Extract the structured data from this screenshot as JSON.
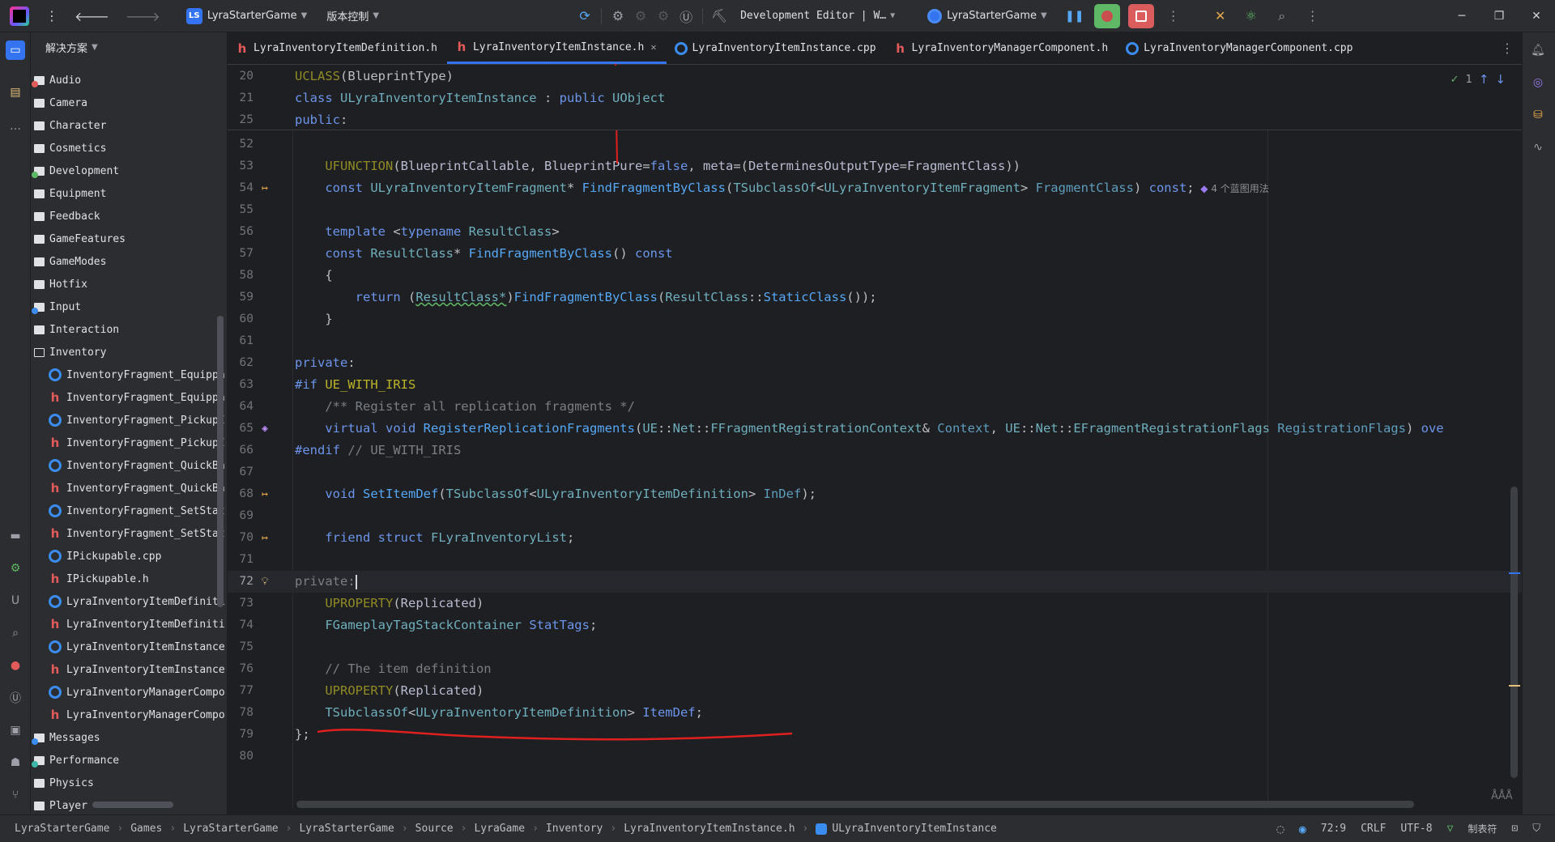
{
  "titlebar": {
    "project_badge": "LS",
    "project_name": "LyraStarterGame",
    "vcs_label": "版本控制",
    "run_config": "Development Editor | W…",
    "target": "LyraStarterGame"
  },
  "project_panel": {
    "header": "解决方案",
    "items": [
      {
        "label": "Audio",
        "kind": "folder",
        "indent": 0,
        "dot": "#e25a5a"
      },
      {
        "label": "Camera",
        "kind": "folder",
        "indent": 0
      },
      {
        "label": "Character",
        "kind": "folder",
        "indent": 0
      },
      {
        "label": "Cosmetics",
        "kind": "folder",
        "indent": 0
      },
      {
        "label": "Development",
        "kind": "folder",
        "indent": 0,
        "dot": "#5fb865"
      },
      {
        "label": "Equipment",
        "kind": "folder",
        "indent": 0
      },
      {
        "label": "Feedback",
        "kind": "folder",
        "indent": 0
      },
      {
        "label": "GameFeatures",
        "kind": "folder",
        "indent": 0
      },
      {
        "label": "GameModes",
        "kind": "folder",
        "indent": 0
      },
      {
        "label": "Hotfix",
        "kind": "folder",
        "indent": 0
      },
      {
        "label": "Input",
        "kind": "folder",
        "indent": 0,
        "dot": "#3b8cef"
      },
      {
        "label": "Interaction",
        "kind": "folder",
        "indent": 0
      },
      {
        "label": "Inventory",
        "kind": "folder-open",
        "indent": 0
      },
      {
        "label": "InventoryFragment_Equippa",
        "kind": "cpp",
        "indent": 1
      },
      {
        "label": "InventoryFragment_Equippa",
        "kind": "h",
        "indent": 1
      },
      {
        "label": "InventoryFragment_PickupI",
        "kind": "cpp",
        "indent": 1
      },
      {
        "label": "InventoryFragment_PickupI",
        "kind": "h",
        "indent": 1
      },
      {
        "label": "InventoryFragment_QuickBa",
        "kind": "cpp",
        "indent": 1
      },
      {
        "label": "InventoryFragment_QuickBa",
        "kind": "h",
        "indent": 1
      },
      {
        "label": "InventoryFragment_SetStat",
        "kind": "cpp",
        "indent": 1
      },
      {
        "label": "InventoryFragment_SetStat",
        "kind": "h",
        "indent": 1
      },
      {
        "label": "IPickupable.cpp",
        "kind": "cpp",
        "indent": 1
      },
      {
        "label": "IPickupable.h",
        "kind": "h",
        "indent": 1
      },
      {
        "label": "LyraInventoryItemDefiniti",
        "kind": "cpp",
        "indent": 1
      },
      {
        "label": "LyraInventoryItemDefiniti",
        "kind": "h",
        "indent": 1
      },
      {
        "label": "LyraInventoryItemInstance",
        "kind": "cpp",
        "indent": 1
      },
      {
        "label": "LyraInventoryItemInstance",
        "kind": "h",
        "indent": 1
      },
      {
        "label": "LyraInventoryManagerCompo",
        "kind": "cpp",
        "indent": 1
      },
      {
        "label": "LyraInventoryManagerCompo",
        "kind": "h",
        "indent": 1
      },
      {
        "label": "Messages",
        "kind": "folder",
        "indent": 0,
        "dot": "#3b8cef"
      },
      {
        "label": "Performance",
        "kind": "folder",
        "indent": 0,
        "dot": "#3bb8a8"
      },
      {
        "label": "Physics",
        "kind": "folder",
        "indent": 0
      },
      {
        "label": "Player",
        "kind": "folder",
        "indent": 0
      }
    ]
  },
  "tabs": [
    {
      "label": "LyraInventoryItemDefinition.h",
      "kind": "h",
      "active": false
    },
    {
      "label": "LyraInventoryItemInstance.h",
      "kind": "h",
      "active": true
    },
    {
      "label": "LyraInventoryItemInstance.cpp",
      "kind": "cpp",
      "active": false
    },
    {
      "label": "LyraInventoryManagerComponent.h",
      "kind": "h",
      "active": false
    },
    {
      "label": "LyraInventoryManagerComponent.cpp",
      "kind": "cpp",
      "active": false
    }
  ],
  "editor": {
    "inspection_count": "1",
    "usage_hint": "4 个蓝图用法",
    "sticky_lines": [
      {
        "n": "20",
        "html": "<span class='macro'>UCLASS</span>(BlueprintType)"
      },
      {
        "n": "21",
        "html": "<span class='kwb'>class</span> <span class='cl'>ULyraInventoryItemInstance</span> : <span class='kwb'>public</span> <span class='cl'>UObject</span>"
      },
      {
        "n": "25",
        "html": "<span class='kwb'>public</span>:"
      }
    ],
    "lines": [
      {
        "n": "52",
        "html": ""
      },
      {
        "n": "53",
        "html": "    <span class='macro'>UFUNCTION</span>(<span class='u1'>BlueprintCallable</span>, <span class='u1'>BlueprintPure</span>=<span class='kwb'>false</span>, <span class='u1'>meta</span>=(<span class='u1'>DeterminesOutputType</span>=<span class='u1'>FragmentClass</span>))"
      },
      {
        "n": "54",
        "g": "impl",
        "html": "    <span class='kwb'>const</span> <span class='cl'>ULyraInventoryItemFragment</span>* <span class='fn'>FindFragmentByClass</span>(<span class='cl'>TSubclassOf</span>&lt;<span class='cl'>ULyraInventoryItemFragment</span>&gt; <span class='par'>FragmentClass</span>) <span class='kwb'>const</span>;",
        "hint": true
      },
      {
        "n": "55",
        "html": ""
      },
      {
        "n": "56",
        "html": "    <span class='kwb'>template</span> &lt;<span class='kwb'>typename</span> <span class='cl'>ResultClass</span>&gt;"
      },
      {
        "n": "57",
        "html": "    <span class='kwb'>const</span> <span class='cl'>ResultClass</span>* <span class='fn'>FindFragmentByClass</span>() <span class='kwb'>const</span>"
      },
      {
        "n": "58",
        "html": "    {"
      },
      {
        "n": "59",
        "html": "        <span class='kwb'>return</span> (<span class='cl' style='text-decoration: underline wavy #5fb865;'>ResultClass*</span>)<span class='fn'>FindFragmentByClass</span>(<span class='cl'>ResultClass</span>::<span class='fn'>StaticClass</span>());"
      },
      {
        "n": "60",
        "html": "    }"
      },
      {
        "n": "61",
        "html": ""
      },
      {
        "n": "62",
        "html": "<span class='kwb'>private</span>:"
      },
      {
        "n": "63",
        "html": "<span class='kwb'>#if</span> <span class='mac2'>UE_WITH_IRIS</span>"
      },
      {
        "n": "64",
        "html": "    <span class='cm'>/** Register all replication fragments */</span>"
      },
      {
        "n": "65",
        "g": "override",
        "html": "    <span class='kwb'>virtual</span> <span class='kwb'>void</span> <span class='fn'>RegisterReplicationFragments</span>(<span class='cl'>UE</span>::<span class='cl'>Net</span>::<span class='cl'>FFragmentRegistrationContext</span>&amp; <span class='par'>Context</span>, <span class='cl'>UE</span>::<span class='cl'>Net</span>::<span class='cl'>EFragmentRegistrationFlags</span> <span class='par'>RegistrationFlags</span>) <span class='kwb'>ove</span>"
      },
      {
        "n": "66",
        "html": "<span class='kwb'>#endif</span> <span class='cm'>// UE_WITH_IRIS</span>"
      },
      {
        "n": "67",
        "html": ""
      },
      {
        "n": "68",
        "g": "impl",
        "html": "    <span class='kwb'>void</span> <span class='fn'>SetItemDef</span>(<span class='cl'>TSubclassOf</span>&lt;<span class='cl'>ULyraInventoryItemDefinition</span>&gt; <span class='par'>InDef</span>);"
      },
      {
        "n": "69",
        "html": ""
      },
      {
        "n": "70",
        "g": "impl",
        "html": "    <span class='kwb'>friend</span> <span class='kwb'>struct</span> <span class='cl'>FLyraInventoryList</span>;"
      },
      {
        "n": "71",
        "html": ""
      },
      {
        "n": "72",
        "g": "bulb",
        "current": true,
        "html": "<span class='cm'>private:</span><span class='caret'></span>"
      },
      {
        "n": "73",
        "html": "    <span class='macro'>UPROPERTY</span>(<span class='u1'>Replicated</span>)"
      },
      {
        "n": "74",
        "html": "    <span class='cl'>FGameplayTagStackContainer</span> <span class='pv'>StatTags</span>;"
      },
      {
        "n": "75",
        "html": ""
      },
      {
        "n": "76",
        "html": "    <span class='cm'>// The item definition</span>"
      },
      {
        "n": "77",
        "html": "    <span class='macro'>UPROPERTY</span>(<span class='u1'>Replicated</span>)"
      },
      {
        "n": "78",
        "html": "    <span class='cl'>TSubclassOf</span>&lt;<span class='cl'>ULyraInventoryItemDefinition</span>&gt; <span class='pv'>ItemDef</span>;"
      },
      {
        "n": "79",
        "html": "};"
      },
      {
        "n": "80",
        "html": ""
      }
    ]
  },
  "statusbar": {
    "crumbs": [
      "LyraStarterGame",
      "Games",
      "LyraStarterGame",
      "LyraStarterGame",
      "Source",
      "LyraGame",
      "Inventory",
      "LyraInventoryItemInstance.h",
      "ULyraInventoryItemInstance"
    ],
    "position": "72:9",
    "line_sep": "CRLF",
    "encoding": "UTF-8",
    "indent": "制表符"
  },
  "colors": {
    "accent": "#3574f0",
    "annotation": "#e0201e"
  }
}
